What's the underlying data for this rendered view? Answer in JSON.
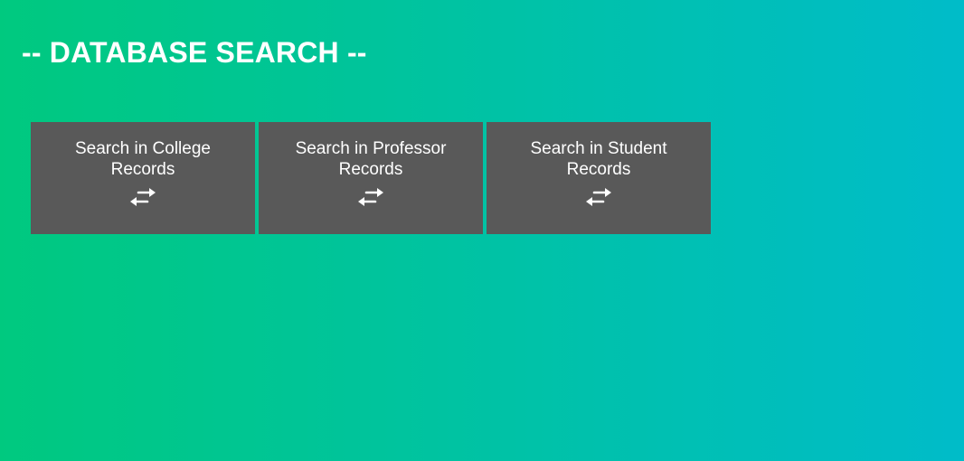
{
  "page": {
    "title": "-- DATABASE SEARCH --"
  },
  "cards": [
    {
      "label": "Search in College Records",
      "icon": "swap-arrows-icon"
    },
    {
      "label": "Search in Professor Records",
      "icon": "swap-arrows-icon"
    },
    {
      "label": "Search in Student Records",
      "icon": "swap-arrows-icon"
    }
  ],
  "colors": {
    "gradient_start": "#00c97f",
    "gradient_end": "#00bcc9",
    "card_background": "#595959",
    "text": "#ffffff"
  }
}
